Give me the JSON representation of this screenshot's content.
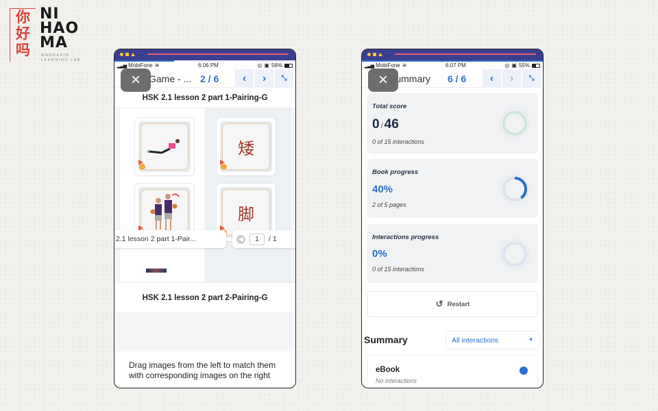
{
  "logo": {
    "chinese": [
      "你",
      "好",
      "吗"
    ],
    "english_lines": [
      "NI",
      "HAO",
      "MA"
    ],
    "subtitle": "MANDARIN LEARNING LAB",
    "accent_color": "#d9423a"
  },
  "left_phone": {
    "status": {
      "carrier": "MobiFone",
      "time": "6:06 PM",
      "battery": "56%",
      "battery_level": 0.56
    },
    "reading_progress": 0.33,
    "nav": {
      "title": "Game - ...",
      "page": "2 / 6",
      "prev_icon": "chevron-left",
      "next_icon": "chevron-right",
      "fullscreen_icon": "exit-fullscreen"
    },
    "close_icon": "×",
    "section1_title": "HSK 2.1 lesson 2 part 1-Pairing-G",
    "cards_left": [
      {
        "type": "image",
        "description": "woman doing sit-ups"
      },
      {
        "type": "image",
        "description": "two basketball players, tall and short"
      }
    ],
    "cards_right": [
      {
        "type": "hanzi",
        "text": "矮"
      },
      {
        "type": "hanzi",
        "text": "脚"
      }
    ],
    "pager": {
      "doc_title": "2.1 lesson 2 part 1-Pair...",
      "current_page": "1",
      "total_pages": "/ 1"
    },
    "section2_title": "HSK 2.1 lesson 2 part 2-Pairing-G",
    "instructions": "Drag images from the left to match them with corresponding images on the right"
  },
  "right_phone": {
    "status": {
      "carrier": "MobiFone",
      "time": "6:07 PM",
      "battery": "55%",
      "battery_level": 0.55
    },
    "reading_progress": 1.0,
    "nav": {
      "title": "Summary",
      "page": "6 / 6",
      "prev_icon": "chevron-left",
      "next_icon": "chevron-right",
      "fullscreen_icon": "exit-fullscreen"
    },
    "close_icon": "×",
    "total_score": {
      "label": "Total score",
      "score": "0",
      "max": "46",
      "sub": "0 of 15 interactions",
      "fraction": 0,
      "color": "#8fcab2"
    },
    "book_progress": {
      "label": "Book progress",
      "value": "40%",
      "sub": "2 of 5 pages",
      "fraction": 0.4,
      "color": "#2a6fcf"
    },
    "interactions_progress": {
      "label": "Interactions progress",
      "value": "0%",
      "sub": "0 of 15 interactions",
      "fraction": 0,
      "color": "#2a6fcf"
    },
    "restart_label": "Restart",
    "summary_heading": "Summary",
    "filter": {
      "selected": "All interactions"
    },
    "items": [
      {
        "title": "eBook",
        "subtitle": "No interactions",
        "status_color": "#2a6fcf"
      }
    ]
  }
}
